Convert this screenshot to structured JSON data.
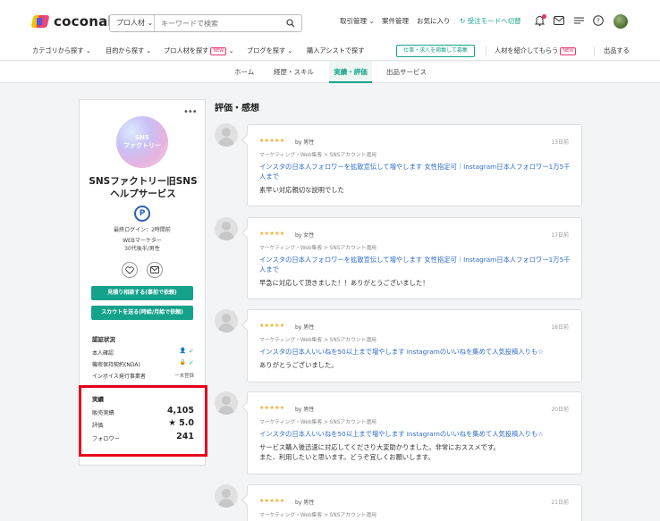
{
  "header": {
    "logo_text": "coconala",
    "search_category": "プロ人材",
    "search_placeholder": "キーワードで検索",
    "nav": [
      "取引管理",
      "案件管理",
      "お気に入り"
    ],
    "mode_switch": "受注モードへ切替"
  },
  "catbar": {
    "items": [
      "カテゴリから探す",
      "目的から探す",
      "プロ人材を探す",
      "ブログを探す",
      "購入アシストで探す"
    ],
    "new_badge": "NEW",
    "post_button": "仕事・求人を掲載して募集",
    "refer": "人材を紹介してもらう",
    "sell": "出品する"
  },
  "tabs": {
    "home": "ホーム",
    "career": "経歴・スキル",
    "achievements": "実績・評価",
    "services": "出品サービス"
  },
  "profile": {
    "image_text": "SNS\nファクトリー",
    "name": "SNSファクトリー旧SNSヘルプサービス",
    "pro_badge": "P",
    "last_login": "最終ログイン：2時間前",
    "job": "WEBマーケター",
    "age_gender": "30代後半/男性",
    "btn_estimate": "見積り相談する(事前で依頼)",
    "btn_scout": "スカウトを送る(時給/月給で依頼)",
    "verification_title": "認証状況",
    "verification": [
      {
        "label": "本人確認",
        "status": "✓"
      },
      {
        "label": "機密保持契約(NDA)",
        "status": "✓"
      },
      {
        "label": "インボイス発行事業者",
        "status": "ー未登録"
      }
    ],
    "stats_title": "実績",
    "stats": [
      {
        "label": "販売実績",
        "value": "4,105"
      },
      {
        "label": "評価",
        "value": "★ 5.0"
      },
      {
        "label": "フォロワー",
        "value": "241"
      }
    ]
  },
  "reviews_title": "評価・感想",
  "reviews": [
    {
      "stars": "★★★★★",
      "by": "by 男性",
      "ago": "13日前",
      "category": "マーケティング・Web集客 > SNSアカウント運用",
      "service": "インスタの日本人フォロワーを拡散宣伝して増やします 女性指定可｜Instagram日本人フォロワー1万5千人まで",
      "comment": "素早い対応親切な説明でした"
    },
    {
      "stars": "★★★★★",
      "by": "by 女性",
      "ago": "17日前",
      "category": "マーケティング・Web集客 > SNSアカウント運用",
      "service": "インスタの日本人フォロワーを拡散宣伝して増やします 女性指定可｜Instagram日本人フォロワー1万5千人まで",
      "comment": "早急に対応して頂きました！！ありがとうございました！"
    },
    {
      "stars": "★★★★★",
      "by": "by 男性",
      "ago": "18日前",
      "category": "マーケティング・Web集客 > SNSアカウント運用",
      "service": "インスタの日本人いいねを50以上まで増やします Instagramのいいねを集めて人気投稿入りも☆",
      "comment": "ありがとうございました。"
    },
    {
      "stars": "★★★★★",
      "by": "by 男性",
      "ago": "20日前",
      "category": "マーケティング・Web集客 > SNSアカウント運用",
      "service": "インスタの日本人いいねを50以上まで増やします Instagramのいいねを集めて人気投稿入りも☆",
      "comment": "サービス購入後迅速に対応してくださり大変助かりました。非常におススメです。\nまた、利用したいと思います。どうぞ宜しくお願いします。"
    },
    {
      "stars": "★★★★★",
      "by": "by 男性",
      "ago": "21日前",
      "category": "マーケティング・Web集客 > SNSアカウント運用",
      "service": "",
      "comment": ""
    }
  ],
  "colors": {
    "accent": "#14a28b",
    "link": "#2f6ccf",
    "star": "#f5a623",
    "highlight": "#e8001c"
  }
}
